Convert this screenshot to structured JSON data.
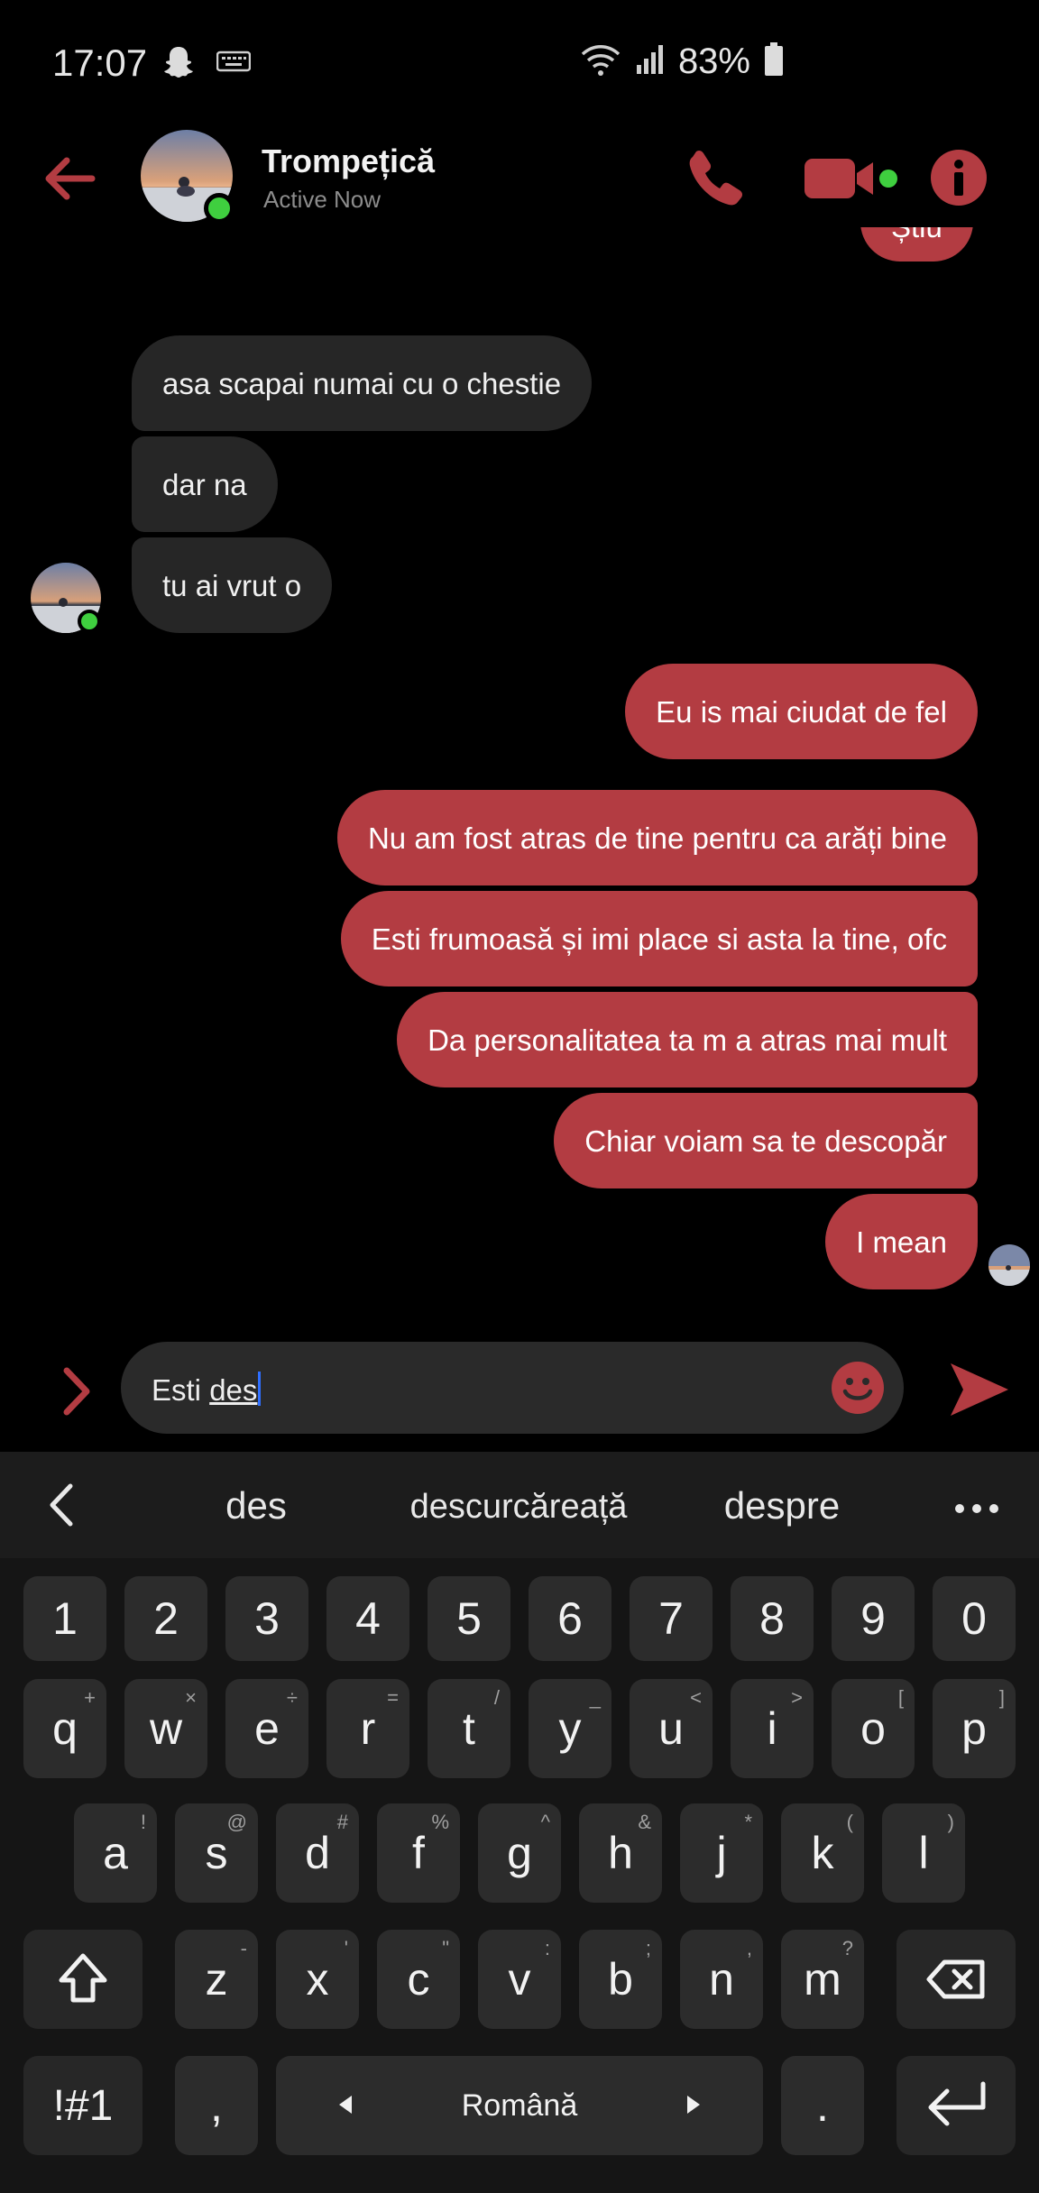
{
  "status": {
    "time": "17:07",
    "battery": "83%",
    "icons": [
      "snapchat-icon",
      "keyboard-icon",
      "wifi-icon",
      "signal-icon",
      "battery-icon"
    ]
  },
  "header": {
    "name": "Trompețică",
    "status": "Active Now"
  },
  "messages": [
    {
      "text": "Știu",
      "side": "out"
    },
    {
      "text": "asa scapai numai cu o chestie",
      "side": "in"
    },
    {
      "text": "dar na",
      "side": "in"
    },
    {
      "text": "tu ai vrut o",
      "side": "in"
    },
    {
      "text": "Eu is mai ciudat de fel",
      "side": "out"
    },
    {
      "text": "Nu am fost atras de tine pentru ca arăți bine",
      "side": "out"
    },
    {
      "text": "Esti frumoasă și imi place si asta la tine, ofc",
      "side": "out"
    },
    {
      "text": "Da personalitatea ta m a atras mai mult",
      "side": "out"
    },
    {
      "text": "Chiar voiam sa te descopăr",
      "side": "out"
    },
    {
      "text": "I mean",
      "side": "out"
    }
  ],
  "composer": {
    "text_prefix": "Esti ",
    "text_typed": "des"
  },
  "keyboard": {
    "suggestions": [
      "des",
      "descurcăreață",
      "despre"
    ],
    "number_row": [
      "1",
      "2",
      "3",
      "4",
      "5",
      "6",
      "7",
      "8",
      "9",
      "0"
    ],
    "row1": [
      {
        "k": "q",
        "s": "+"
      },
      {
        "k": "w",
        "s": "×"
      },
      {
        "k": "e",
        "s": "÷"
      },
      {
        "k": "r",
        "s": "="
      },
      {
        "k": "t",
        "s": "/"
      },
      {
        "k": "y",
        "s": "_"
      },
      {
        "k": "u",
        "s": "<"
      },
      {
        "k": "i",
        "s": ">"
      },
      {
        "k": "o",
        "s": "["
      },
      {
        "k": "p",
        "s": "]"
      }
    ],
    "row2": [
      {
        "k": "a",
        "s": "!"
      },
      {
        "k": "s",
        "s": "@"
      },
      {
        "k": "d",
        "s": "#"
      },
      {
        "k": "f",
        "s": "%"
      },
      {
        "k": "g",
        "s": "^"
      },
      {
        "k": "h",
        "s": "&"
      },
      {
        "k": "j",
        "s": "*"
      },
      {
        "k": "k",
        "s": "("
      },
      {
        "k": "l",
        "s": ")"
      }
    ],
    "row3": [
      {
        "k": "z",
        "s": "-"
      },
      {
        "k": "x",
        "s": "'"
      },
      {
        "k": "c",
        "s": "\""
      },
      {
        "k": "v",
        "s": ":"
      },
      {
        "k": "b",
        "s": ";"
      },
      {
        "k": "n",
        "s": ","
      },
      {
        "k": "m",
        "s": "?"
      }
    ],
    "symbols_label": "!#1",
    "comma": ",",
    "space_label": "Română",
    "period": "."
  },
  "colors": {
    "accent": "#b33c42",
    "incoming": "#262626",
    "online": "#3fcf3f"
  }
}
